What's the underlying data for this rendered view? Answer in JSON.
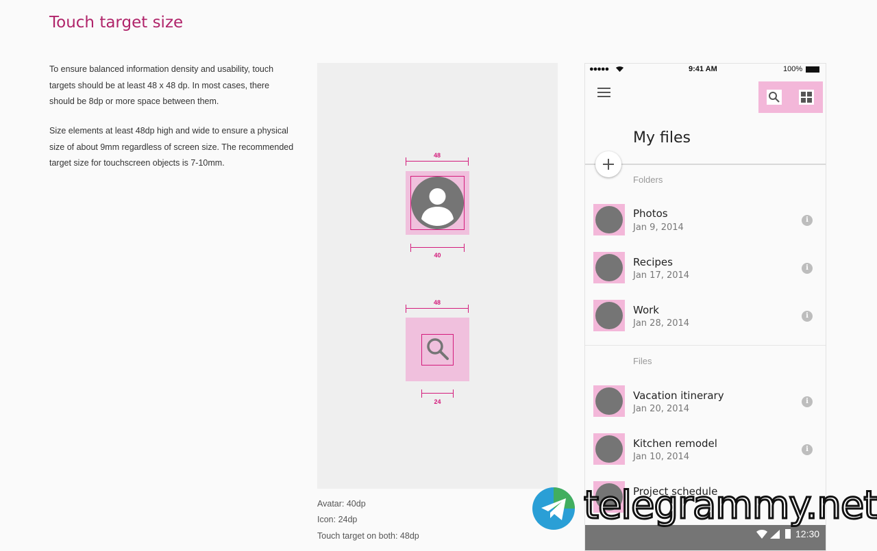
{
  "page": {
    "title": "Touch target size",
    "paragraphs": [
      "To ensure balanced information density and usability, touch targets should be at least 48 x 48 dp. In most cases, there should be 8dp or more space between them.",
      "Size elements at least 48dp high and wide to ensure a physical size of about 9mm regardless of screen size. The recommended target size for touchscreen objects is 7-10mm."
    ]
  },
  "diagram": {
    "avatar_target_label": "48",
    "avatar_size_label": "40",
    "icon_target_label": "48",
    "icon_size_label": "24",
    "captions": [
      "Avatar: 40dp",
      "Icon: 24dp",
      "Touch target on both: 48dp"
    ]
  },
  "phone": {
    "status_time": "9:41 AM",
    "status_battery": "100%",
    "screen_title": "My files",
    "sections": [
      {
        "label": "Folders",
        "items": [
          {
            "name": "Photos",
            "date": "Jan 9, 2014"
          },
          {
            "name": "Recipes",
            "date": "Jan 17, 2014"
          },
          {
            "name": "Work",
            "date": "Jan 28, 2014"
          }
        ]
      },
      {
        "label": "Files",
        "items": [
          {
            "name": "Vacation itinerary",
            "date": "Jan 20, 2014"
          },
          {
            "name": "Kitchen remodel",
            "date": "Jan 10, 2014"
          },
          {
            "name": "Project schedule",
            "date": ""
          }
        ]
      }
    ],
    "android_time": "12:30",
    "icons": [
      "menu-icon",
      "search-icon",
      "grid-view-icon",
      "add-icon",
      "info-icon"
    ]
  },
  "watermark": {
    "text": "telegrammy.net"
  },
  "colors": {
    "accent": "#b0246a",
    "target_pink": "#f3b7d9",
    "measure_magenta": "#d31a7b",
    "avatar_grey": "#757575"
  }
}
